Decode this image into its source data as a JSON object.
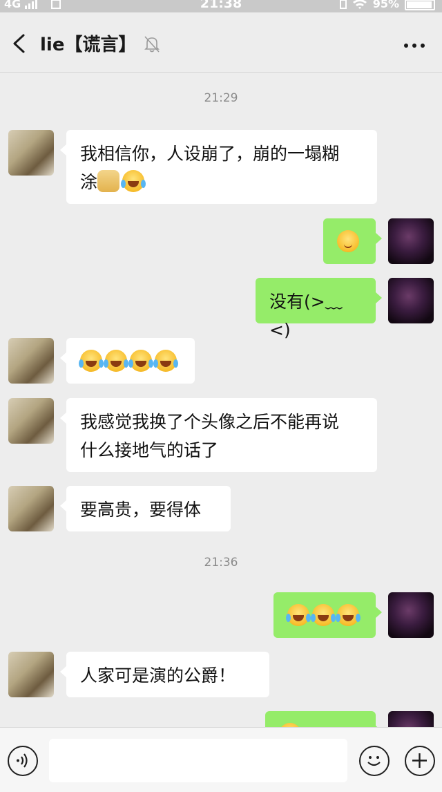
{
  "status_bar": {
    "network": "4G",
    "time": "21:38",
    "battery": "95%",
    "battery_level": 0.95
  },
  "header": {
    "title": "lie【谎言】"
  },
  "messages": [
    {
      "type": "time",
      "text": "21:29"
    },
    {
      "side": "left",
      "text": "我相信你，人设崩了，崩的一塌糊",
      "text2": "涂",
      "emojis": [
        "doge",
        "laugh-cry"
      ]
    },
    {
      "side": "right",
      "text": "",
      "emojis": [
        "blush"
      ]
    },
    {
      "side": "right",
      "text": "没有(>﹏<)"
    },
    {
      "side": "left",
      "text": "",
      "emojis": [
        "laugh-cry",
        "laugh-cry",
        "laugh-cry",
        "laugh-cry"
      ]
    },
    {
      "side": "left",
      "text": "我感觉我换了个头像之后不能再说",
      "text2": "什么接地气的话了"
    },
    {
      "side": "left",
      "text": "要高贵，要得体"
    },
    {
      "type": "time",
      "text": "21:36"
    },
    {
      "side": "right",
      "text": "",
      "emojis": [
        "laugh-cry",
        "laugh-cry",
        "laugh-cry"
      ]
    },
    {
      "side": "left",
      "text": "人家可是演的公爵！"
    }
  ],
  "input": {
    "value": ""
  },
  "icons": {
    "back": "back-icon",
    "mute": "bell-off-icon",
    "more": "more-icon",
    "voice": "voice-icon",
    "emoji": "emoji-icon",
    "plus": "plus-icon"
  },
  "colors": {
    "background": "#ededed",
    "sent_bubble": "#95ec69",
    "received_bubble": "#ffffff"
  }
}
